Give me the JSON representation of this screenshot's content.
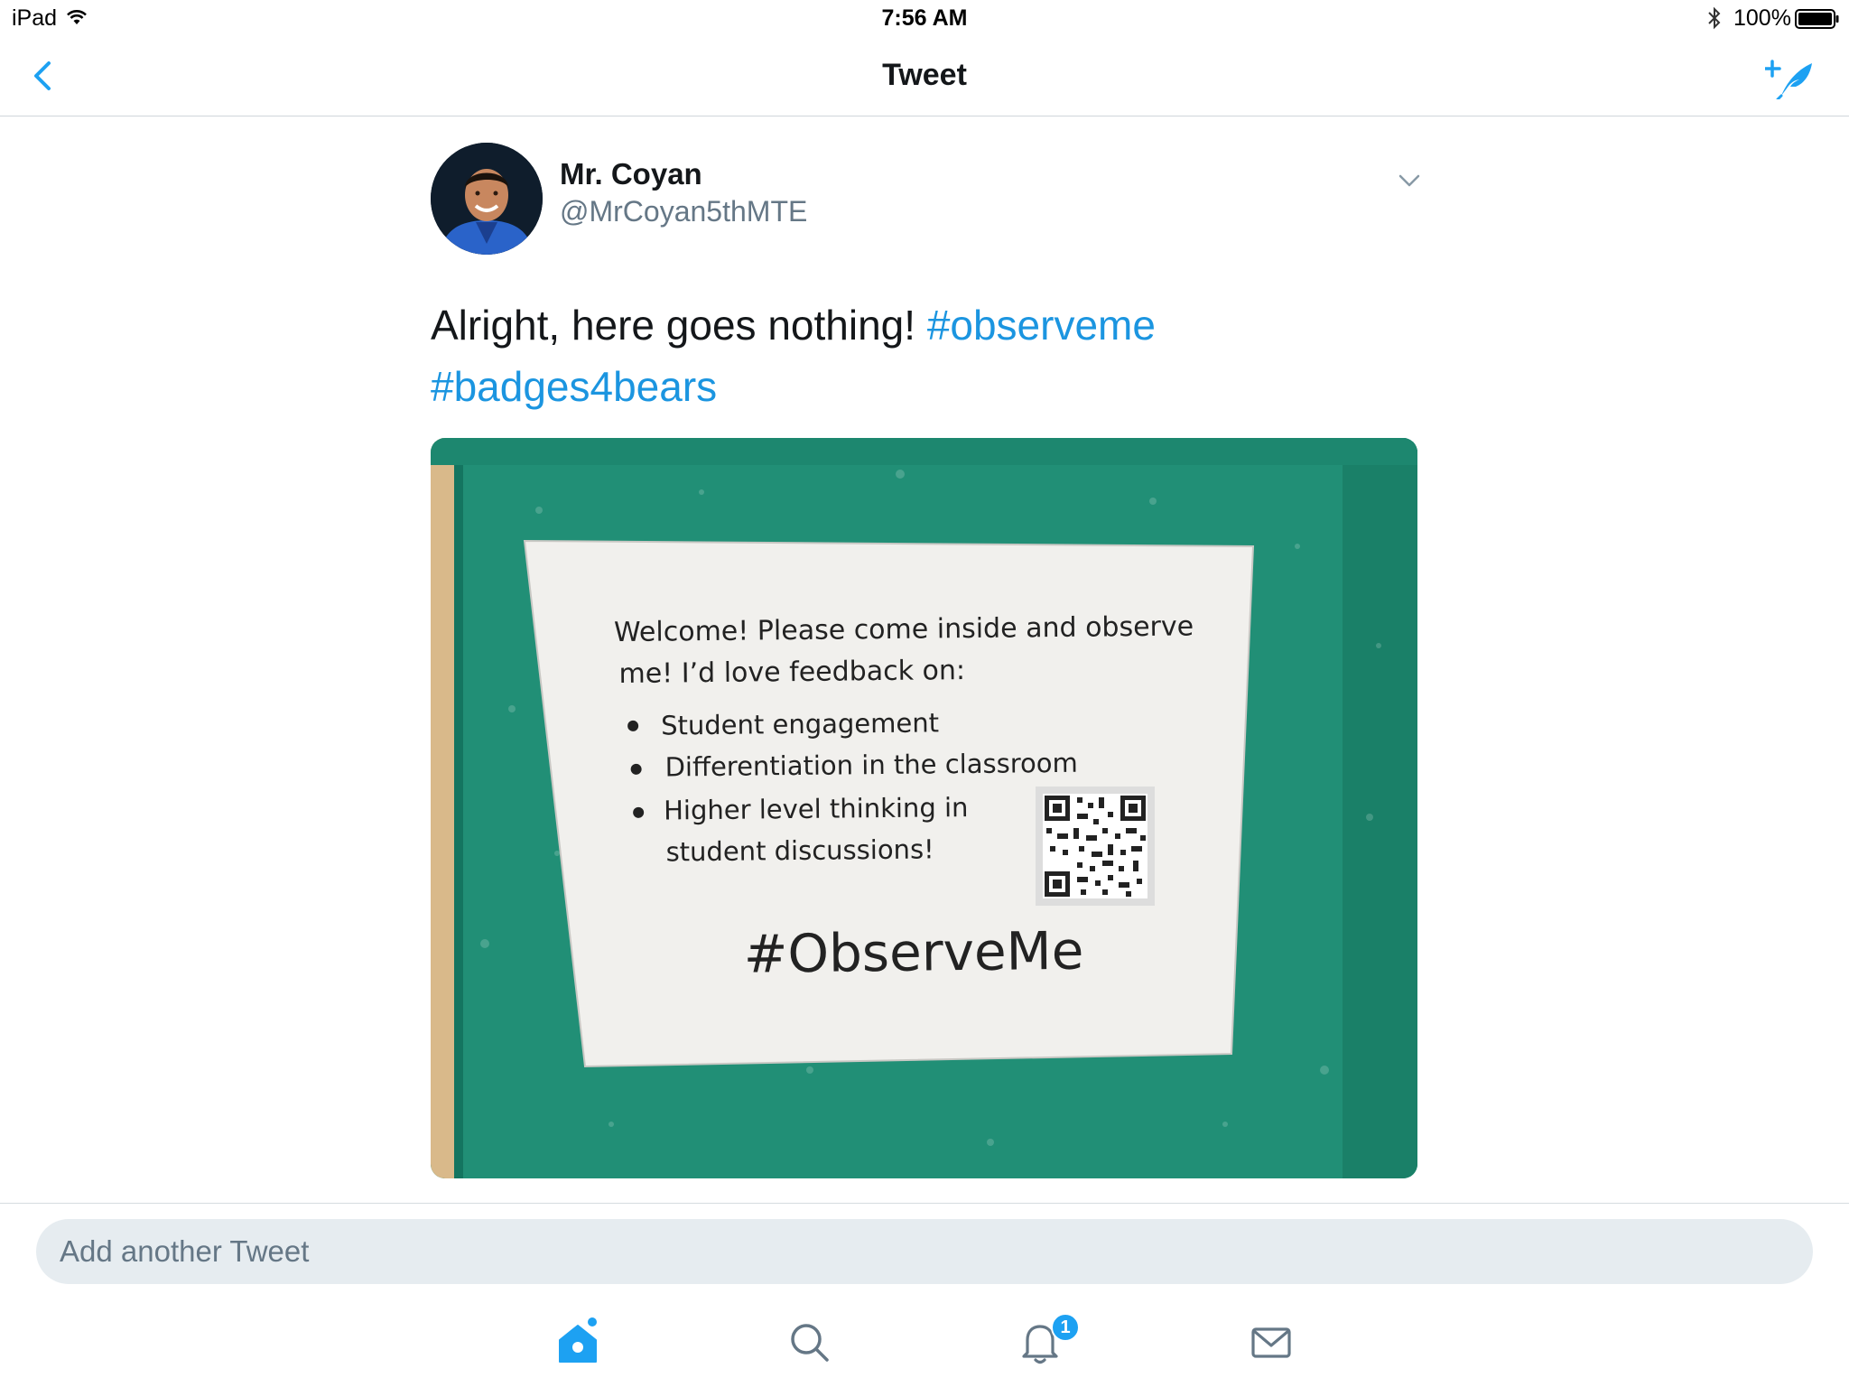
{
  "status_bar": {
    "device": "iPad",
    "time": "7:56 AM",
    "battery": "100%"
  },
  "nav": {
    "title": "Tweet",
    "back_icon": "chevron-left-icon",
    "compose_icon": "compose-tweet-icon"
  },
  "tweet": {
    "author_name": "Mr. Coyan",
    "author_handle": "@MrCoyan5thMTE",
    "text_plain": "Alright, here goes nothing!",
    "hashtags": [
      "#observeme",
      "#badges4bears"
    ],
    "media": {
      "sign_intro_line1": "Welcome!  Please come inside and observe",
      "sign_intro_line2": "me!  I’d love feedback on:",
      "sign_bullets": [
        "Student engagement",
        "Differentiation in the classroom",
        "Higher level thinking in",
        "student discussions!"
      ],
      "sign_hashtag": "#ObserveMe"
    }
  },
  "reply": {
    "placeholder": "Add another Tweet"
  },
  "tab_bar": {
    "items": [
      {
        "name": "home",
        "icon": "home-icon"
      },
      {
        "name": "search",
        "icon": "search-icon"
      },
      {
        "name": "notifications",
        "icon": "bell-icon",
        "badge": "1"
      },
      {
        "name": "messages",
        "icon": "envelope-icon"
      }
    ]
  },
  "colors": {
    "accent": "#1da1f2",
    "hashtag": "#1b95e0",
    "text": "#14171a",
    "secondary": "#657786",
    "media_wall": "#1f8e74"
  }
}
